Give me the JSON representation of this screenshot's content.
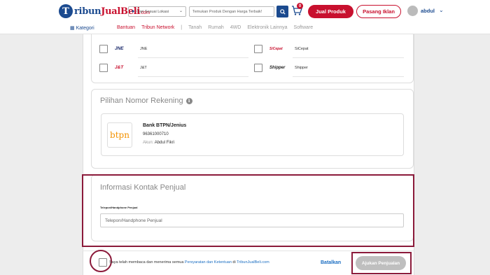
{
  "header": {
    "logo_mark": "T",
    "logo_main": "ribun",
    "logo_accent": "JualBeli",
    "logo_suffix": ".com",
    "location_placeholder": "Cari Sesuai Lokasi",
    "search_placeholder": "Temukan Produk Dengan Harga Terbaik!",
    "cart_count": "0",
    "jual_label": "Jual Produk",
    "iklan_label": "Pasang Iklan",
    "username": "abdul"
  },
  "nav": {
    "kategori": "Kategori",
    "links": [
      "Bantuan",
      "Tribun Network",
      "Tanah",
      "Rumah",
      "4WD",
      "Elektronik Lainnya",
      "Software"
    ],
    "separator": "|"
  },
  "couriers": [
    {
      "logo": "JNE",
      "name": "JNE"
    },
    {
      "logo": "SiCepat",
      "name": "SiCepat"
    },
    {
      "logo": "J&T",
      "name": "J&T"
    },
    {
      "logo": "Shipper",
      "name": "Shipper"
    }
  ],
  "rekening": {
    "title": "Pilihan Nomor Rekening",
    "bank_logo": "btpn",
    "bank_name": "Bank BTPN/Jenius",
    "account_number": "96361000710",
    "akun_label": "Akun:",
    "akun_name": "Abdul Fikri"
  },
  "kontak": {
    "title": "Informasi Kontak Penjual",
    "field_label": "Telepon/Handphone Penjual",
    "placeholder": "Telepon/Handphone Penjual"
  },
  "footer": {
    "agree_prefix": "Saya telah membaca dan menerima semua",
    "agree_link": "Persyaratan dan Ketentuan",
    "agree_mid": "di",
    "agree_site": "TribunJualBeli.com",
    "cancel_label": "Batalkan",
    "submit_label": "Ajukan Penjualan"
  },
  "colors": {
    "brand_blue": "#1b4a8f",
    "brand_red": "#c8102e",
    "highlight": "#8b1a3a"
  }
}
